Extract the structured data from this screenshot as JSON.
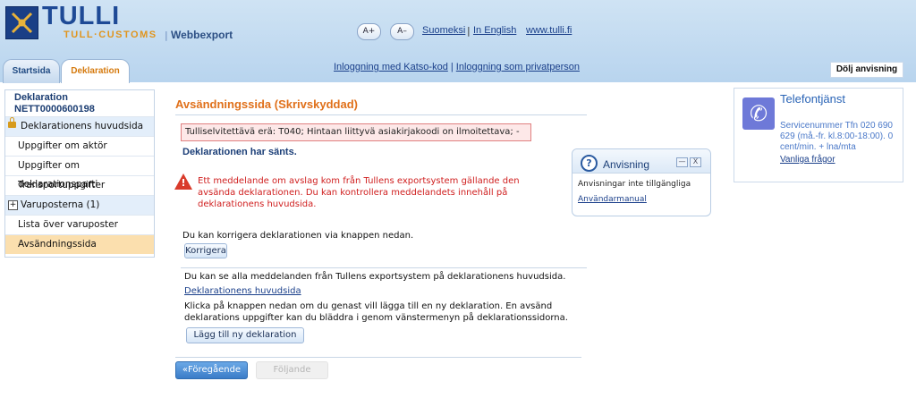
{
  "header": {
    "logo_title": "TULLI",
    "logo_subtitle": "TULL·CUSTOMS",
    "separator": "|",
    "app_name": "Webbexport",
    "font_increase": "A+",
    "font_decrease": "A–",
    "lang_finnish": "Suomeksi",
    "lang_sep1": "|",
    "lang_english": "In English",
    "site_link": "www.tulli.fi"
  },
  "tabs": [
    {
      "label": "Startsida",
      "active": false
    },
    {
      "label": "Deklaration",
      "active": true
    }
  ],
  "login": {
    "katso": "Inloggning med Katso-kod",
    "sep": "|",
    "private": "Inloggning som privatperson"
  },
  "hide_menu_label": "Dölj anvisning",
  "sidebar": {
    "title": "Deklaration",
    "declaration_id": "NETT0000600198",
    "items": [
      {
        "label": "Deklarationens huvudsida"
      },
      {
        "label": "Uppgifter om aktör"
      },
      {
        "label": "Uppgifter om deklarationsparti"
      },
      {
        "label": "Transportuppgifter"
      },
      {
        "label": "Varuposterna (1)"
      },
      {
        "label": "Lista över varuposter"
      },
      {
        "label": "Avsändningssida"
      }
    ]
  },
  "main": {
    "title": "Avsändningssida  (Skrivskyddad)",
    "error_message": "Tulliselvitettävä erä: T040; Hintaan liittyvä asiakirjakoodi on ilmoitettava; -",
    "sent_message": "Deklarationen har sänts.",
    "warning_text": "Ett meddelande om avslag kom från Tullens exportsystem gällande den avsända deklarationen. Du kan kontrollera meddelandets innehåll på deklarationens huvudsida.",
    "correct_text": "Du kan korrigera deklarationen via knappen nedan.",
    "correct_button": "Korrigera",
    "messages_text": "Du kan se alla meddelanden från Tullens exportsystem på deklarationens huvudsida.",
    "main_page_link": "Deklarationens huvudsida",
    "new_decl_text": "Klicka på knappen nedan om du genast vill lägga till en ny deklaration. En avsänd deklarations uppgifter kan du bläddra i genom vänstermenyn på deklarationssidorna.",
    "new_decl_button": "Lägg till ny deklaration",
    "prev_button": "«Föregående",
    "next_button": "Följande"
  },
  "hint": {
    "title": "Anvisning",
    "min_icon": "—",
    "close_icon": "X",
    "body": "Anvisningar inte tillgängliga",
    "link": "Användarmanual"
  },
  "phone": {
    "title": "Telefontjänst",
    "text": "Servicenummer Tfn 020 690 629 (må.-fr. kl.8:00-18:00). 0 cent/min. + lna/mta",
    "link": "Vanliga frågor"
  },
  "colors": {
    "accent_orange": "#e0701a",
    "error_red": "#d02020",
    "link_blue": "#1a3f8a",
    "header_blue": "#b8d4ee",
    "selected_item": "#fbdfae"
  }
}
